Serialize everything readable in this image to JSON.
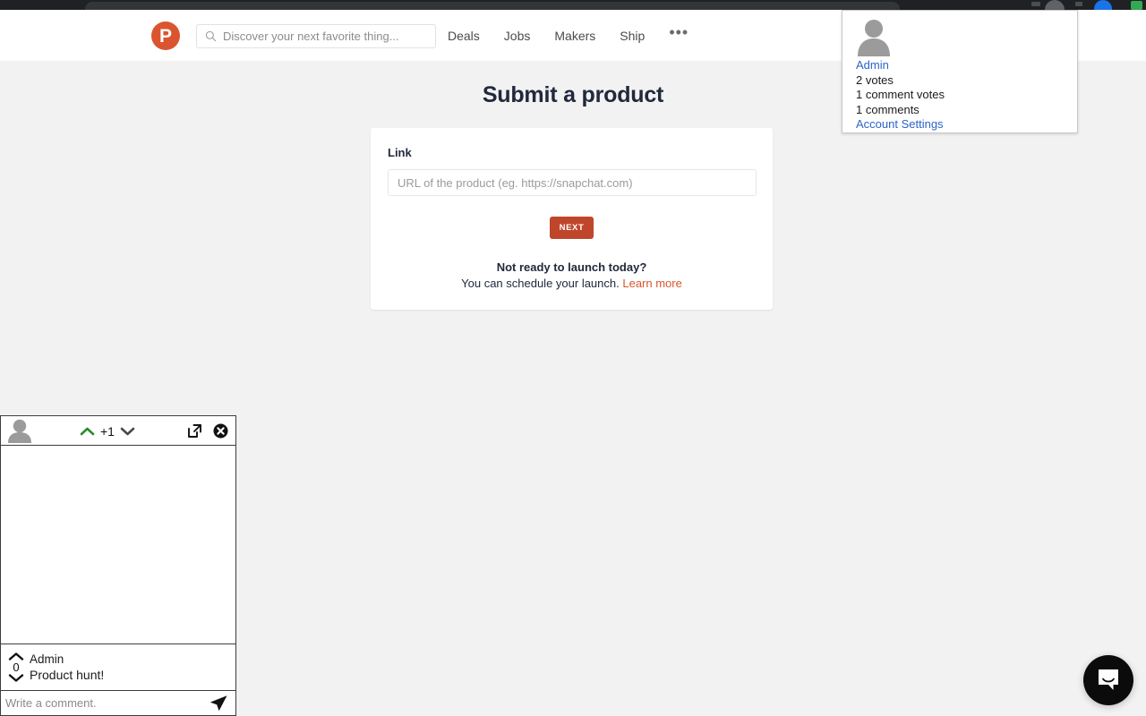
{
  "browser": {
    "icons": [
      "profile-circle-icon",
      "extension-blue-icon",
      "extension-green-icon"
    ]
  },
  "header": {
    "logo_letter": "P",
    "logo_color": "#da552f",
    "search": {
      "icon": "search-icon",
      "placeholder": "Discover your next favorite thing...",
      "value": ""
    },
    "nav": [
      {
        "label": "Deals"
      },
      {
        "label": "Jobs"
      },
      {
        "label": "Makers"
      },
      {
        "label": "Ship"
      }
    ],
    "more_label": "•••"
  },
  "main": {
    "title": "Submit a product",
    "card": {
      "link_label": "Link",
      "url_placeholder": "URL of the product (eg. https://snapchat.com)",
      "url_value": "",
      "next_label": "NEXT",
      "next_color": "#c0462b",
      "schedule_title": "Not ready to launch today?",
      "schedule_text": "You can schedule your launch. ",
      "learn_more_label": "Learn more",
      "learn_more_color": "#da552f"
    }
  },
  "account_dropdown": {
    "avatar": "default-user-avatar",
    "username": "Admin",
    "username_color": "#2d63c8",
    "stats": [
      "2 votes",
      "1 comment votes",
      "1 comments"
    ],
    "settings_label": "Account Settings"
  },
  "comment_widget": {
    "header": {
      "avatar": "default-user-avatar",
      "upvote_icon": "chevron-up-icon",
      "upvote_color": "#2e8b2e",
      "vote_count": "+1",
      "downvote_icon": "chevron-down-icon",
      "popout_icon": "external-link-icon",
      "close_icon": "close-circle-icon"
    },
    "comment": {
      "vote_count": "0",
      "author": "Admin",
      "body": "Product hunt!"
    },
    "input": {
      "placeholder": "Write a comment.",
      "value": "",
      "send_icon": "send-paper-plane-icon"
    }
  },
  "intercom": {
    "icon": "chat-bubble-smile-icon",
    "color": "#0b0b0b"
  }
}
